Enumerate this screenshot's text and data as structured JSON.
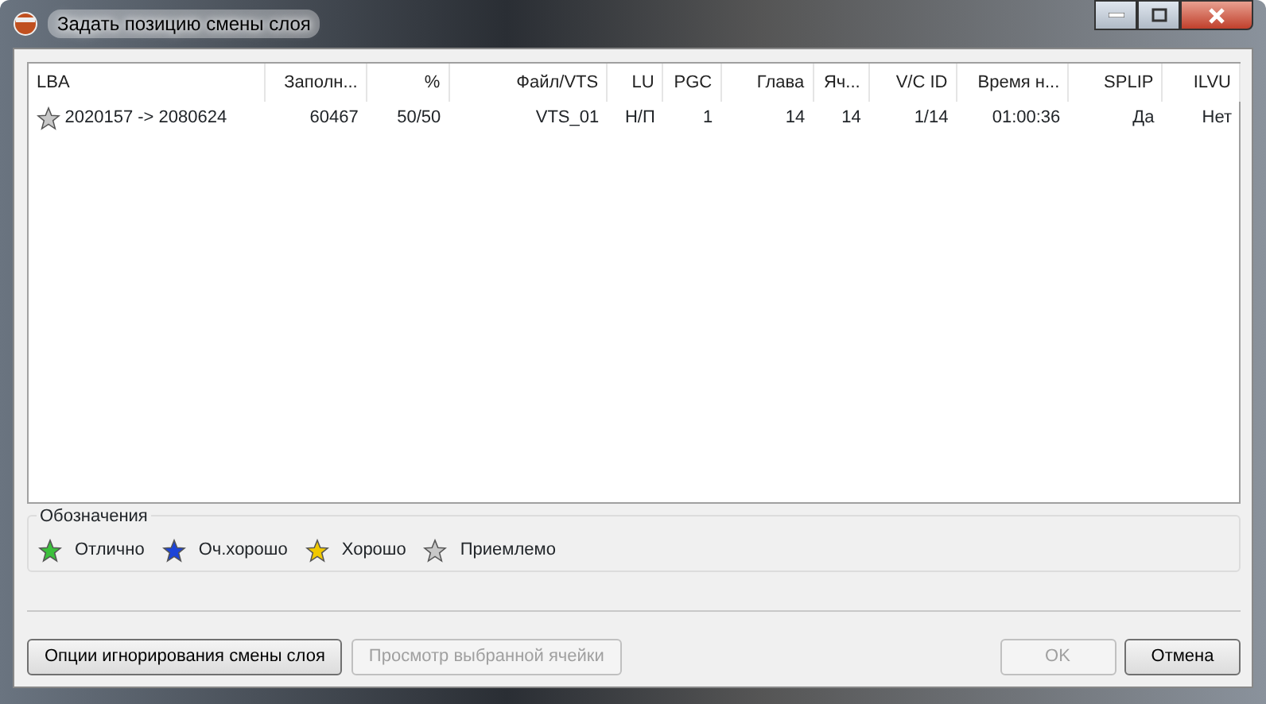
{
  "window": {
    "title": "Задать позицию смены слоя"
  },
  "table": {
    "columns": [
      {
        "label": "LBA"
      },
      {
        "label": "Заполн..."
      },
      {
        "label": "%"
      },
      {
        "label": "Файл/VTS"
      },
      {
        "label": "LU"
      },
      {
        "label": "PGC"
      },
      {
        "label": "Глава"
      },
      {
        "label": "Яч..."
      },
      {
        "label": "V/C ID"
      },
      {
        "label": "Время н..."
      },
      {
        "label": "SPLIP"
      },
      {
        "label": "ILVU"
      }
    ],
    "rows": [
      {
        "color": "#c8c8c8",
        "cells": [
          "2020157 -> 2080624",
          "60467",
          "50/50",
          "VTS_01",
          "Н/П",
          "1",
          "14",
          "14",
          "1/14",
          "01:00:36",
          "Да",
          "Нет"
        ]
      }
    ]
  },
  "legend": {
    "title": "Обозначения",
    "items": [
      {
        "label": "Отлично",
        "color": "#3cc03c"
      },
      {
        "label": "Оч.хорошо",
        "color": "#1c44d8"
      },
      {
        "label": "Хорошо",
        "color": "#f0c800"
      },
      {
        "label": "Приемлемо",
        "color": "#c8c8c8"
      }
    ]
  },
  "buttons": {
    "left": [
      {
        "label": "Опции игнорирования смены слоя",
        "disabled": false
      },
      {
        "label": "Просмотр выбранной ячейки",
        "disabled": true
      }
    ],
    "right": [
      {
        "label": "OK",
        "disabled": true
      },
      {
        "label": "Отмена",
        "disabled": false
      }
    ]
  }
}
